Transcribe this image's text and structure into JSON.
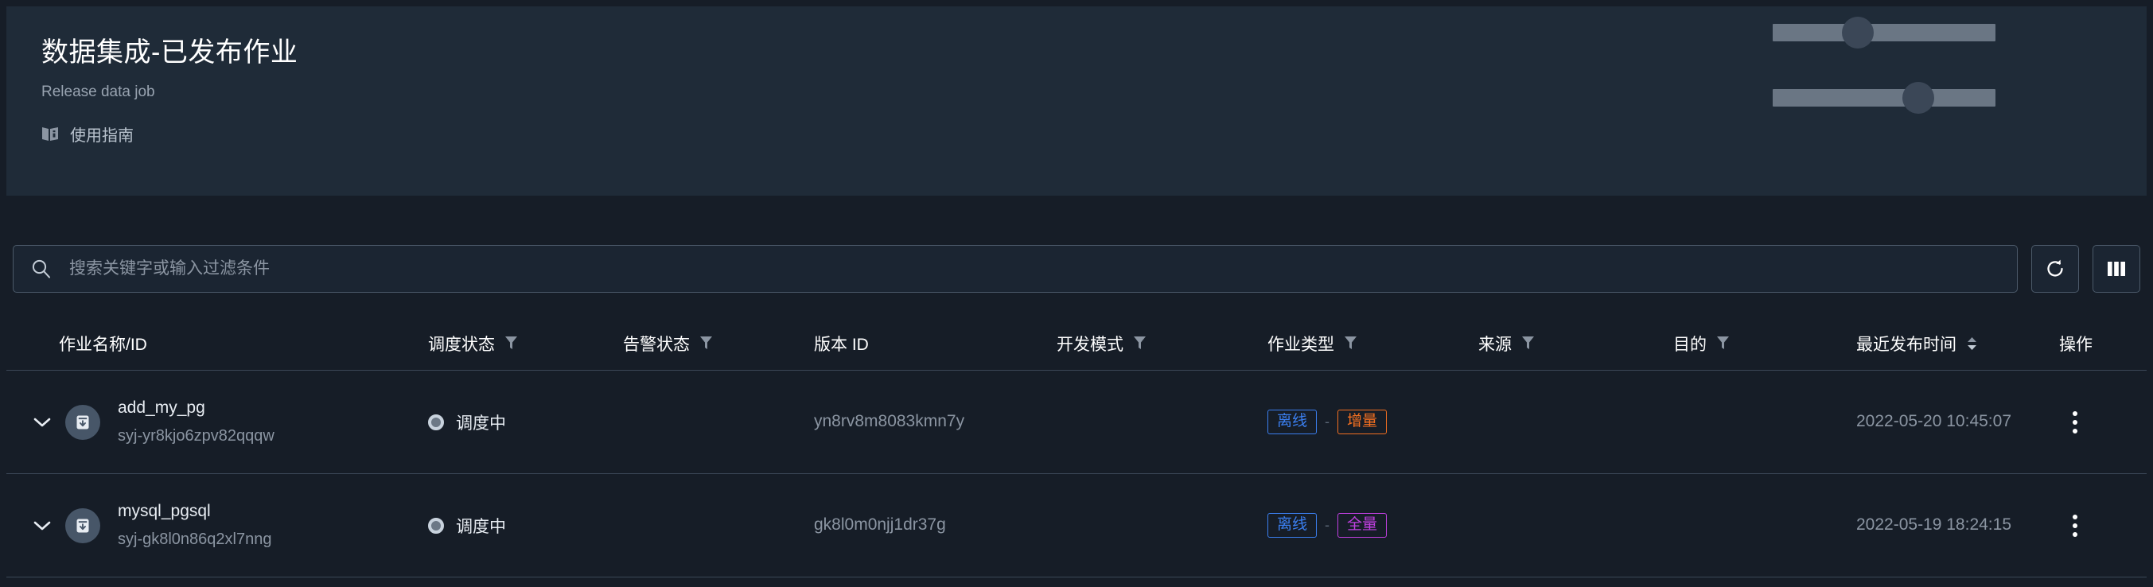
{
  "colors": {
    "page_bg": "#161d27",
    "panel_bg": "#1f2b38",
    "border": "#3b4757",
    "tag_offline": "#3b7ff0",
    "tag_incremental": "#f26f21",
    "tag_full": "#c040e0",
    "muted_text": "#8b95a2"
  },
  "header": {
    "title": "数据集成-已发布作业",
    "subtitle": "Release data job",
    "guide_icon": "book-icon",
    "guide_label": "使用指南",
    "skeletons": [
      {
        "name": "slider-1",
        "thumb_percent": 31
      },
      {
        "name": "slider-2",
        "thumb_percent": 58
      }
    ]
  },
  "toolbar": {
    "search_icon": "search-icon",
    "search_value": "",
    "search_placeholder": "搜索关键字或输入过滤条件",
    "refresh_icon": "refresh-icon",
    "columns_icon": "columns-icon"
  },
  "table": {
    "columns": [
      {
        "key": "name",
        "label": "作业名称/ID",
        "filter": false,
        "sort": false
      },
      {
        "key": "sched",
        "label": "调度状态",
        "filter": true,
        "sort": false
      },
      {
        "key": "alarm",
        "label": "告警状态",
        "filter": true,
        "sort": false
      },
      {
        "key": "version",
        "label": "版本 ID",
        "filter": false,
        "sort": false
      },
      {
        "key": "devmode",
        "label": "开发模式",
        "filter": true,
        "sort": false
      },
      {
        "key": "jobtype",
        "label": "作业类型",
        "filter": true,
        "sort": false
      },
      {
        "key": "source",
        "label": "来源",
        "filter": true,
        "sort": false
      },
      {
        "key": "target",
        "label": "目的",
        "filter": true,
        "sort": false
      },
      {
        "key": "time",
        "label": "最近发布时间",
        "filter": false,
        "sort": true
      },
      {
        "key": "action",
        "label": "操作",
        "filter": false,
        "sort": false
      }
    ],
    "rows": [
      {
        "expander_icon": "chevron-down-icon",
        "job_icon": "job-package-icon",
        "name": "add_my_pg",
        "id": "syj-yr8kjo6zpv82qqqw",
        "sched_status": "调度中",
        "sched_status_icon": "status-running-icon",
        "alarm_status": "",
        "version": "yn8rv8m8083kmn7y",
        "devmode": "",
        "tags": [
          {
            "label": "离线",
            "color": "#3b7ff0"
          },
          {
            "label": "增量",
            "color": "#f26f21"
          }
        ],
        "tag_separator": "-",
        "source": "",
        "target": "",
        "time": "2022-05-20 10:45:07",
        "action_icon": "more-vertical-icon"
      },
      {
        "expander_icon": "chevron-down-icon",
        "job_icon": "job-package-icon",
        "name": "mysql_pgsql",
        "id": "syj-gk8l0n86q2xl7nng",
        "sched_status": "调度中",
        "sched_status_icon": "status-running-icon",
        "alarm_status": "",
        "version": "gk8l0m0njj1dr37g",
        "devmode": "",
        "tags": [
          {
            "label": "离线",
            "color": "#3b7ff0"
          },
          {
            "label": "全量",
            "color": "#c040e0"
          }
        ],
        "tag_separator": "-",
        "source": "",
        "target": "",
        "time": "2022-05-19 18:24:15",
        "action_icon": "more-vertical-icon"
      }
    ]
  }
}
